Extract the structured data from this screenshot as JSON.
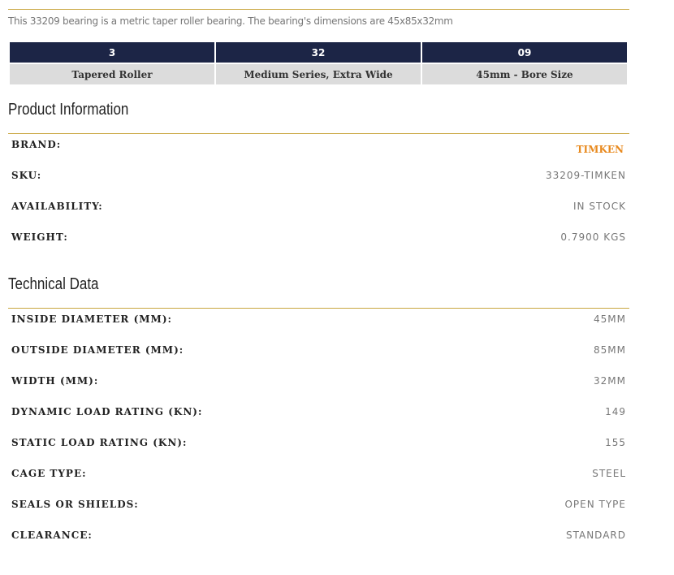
{
  "description": "This 33209 bearing is a metric taper roller bearing. The bearing's dimensions are 45x85x32mm",
  "codes": {
    "headers": [
      "3",
      "32",
      "09"
    ],
    "meanings": [
      "Tapered Roller",
      "Medium Series, Extra Wide",
      "45mm - Bore Size"
    ]
  },
  "product_info": {
    "title": "Product Information",
    "brand_label": "BRAND:",
    "brand_value": "TIMKEN",
    "brand_color": "#e8891d",
    "rows": [
      {
        "label": "SKU:",
        "value": "33209-TIMKEN"
      },
      {
        "label": "AVAILABILITY:",
        "value": "IN STOCK"
      },
      {
        "label": "WEIGHT:",
        "value": "0.7900 KGS"
      }
    ]
  },
  "technical": {
    "title": "Technical Data",
    "rows": [
      {
        "label": "INSIDE DIAMETER (MM):",
        "value": "45MM"
      },
      {
        "label": "OUTSIDE DIAMETER (MM):",
        "value": "85MM"
      },
      {
        "label": "WIDTH (MM):",
        "value": "32MM"
      },
      {
        "label": "DYNAMIC LOAD RATING (KN):",
        "value": "149"
      },
      {
        "label": "STATIC LOAD RATING (KN):",
        "value": "155"
      },
      {
        "label": "CAGE TYPE:",
        "value": "STEEL"
      },
      {
        "label": "SEALS OR SHIELDS:",
        "value": "OPEN TYPE"
      },
      {
        "label": "CLEARANCE:",
        "value": "STANDARD"
      }
    ]
  }
}
